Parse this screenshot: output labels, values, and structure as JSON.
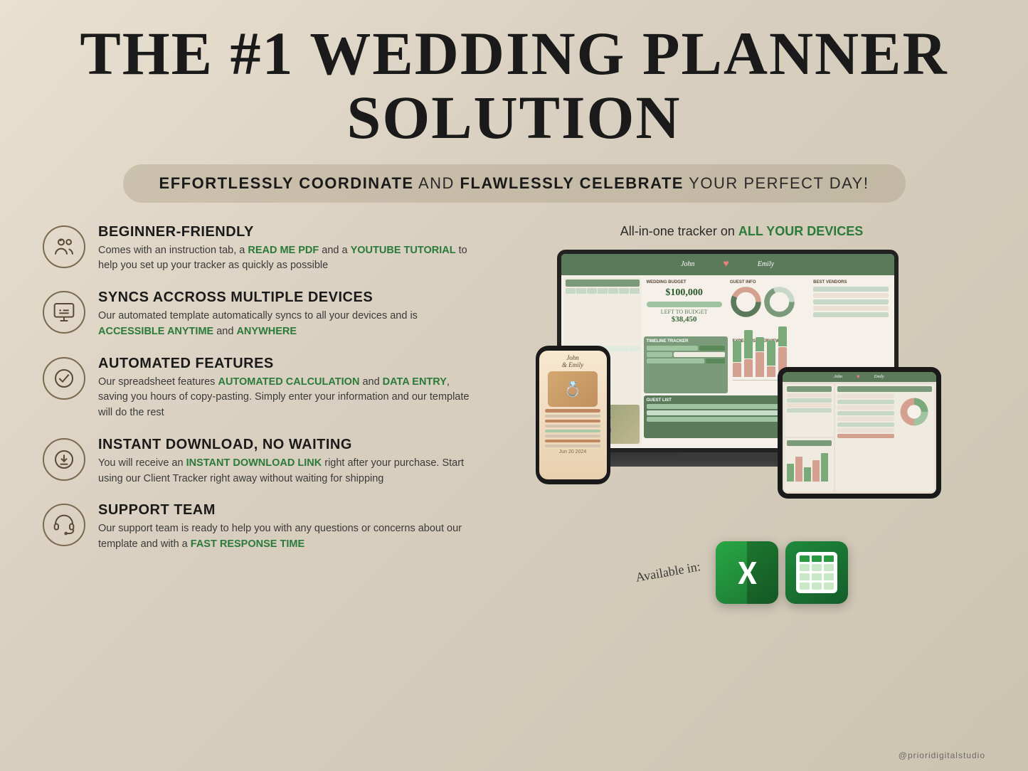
{
  "header": {
    "title_line1": "THE #1 WEDDING PLANNER",
    "title_line2": "SOLUTION",
    "subtitle_bold1": "EFFORTLESSLY COORDINATE",
    "subtitle_and": " AND ",
    "subtitle_bold2": "FLAWLESSLY CELEBRATE",
    "subtitle_rest": " YOUR PERFECT DAY!"
  },
  "features": [
    {
      "id": "beginner",
      "title": "BEGINNER-FRIENDLY",
      "desc_before": "Comes with an instruction tab, a ",
      "link1": "READ ME PDF",
      "desc_mid": " and a ",
      "link2": "YOUTUBE TUTORIAL",
      "desc_after": " to help you set up your tracker as quickly as possible",
      "icon": "users-icon"
    },
    {
      "id": "syncs",
      "title": "SYNCS ACCROSS MULTIPLE DEVICES",
      "desc_before": "Our automated template automatically syncs to all your devices and is ",
      "link1": "ACCESSIBLE ANYTIME",
      "desc_mid": " and ",
      "link2": "ANYWHERE",
      "desc_after": "",
      "icon": "monitor-icon"
    },
    {
      "id": "automated",
      "title": "AUTOMATED FEATURES",
      "desc_before": "Our spreadsheet features ",
      "link1": "AUTOMATED CALCULATION",
      "desc_mid": " and ",
      "link2": "DATA ENTRY",
      "desc_after": ", saving you hours of copy-pasting. Simply enter your information and our template will do the rest",
      "icon": "check-circle-icon"
    },
    {
      "id": "download",
      "title": "INSTANT DOWNLOAD, NO WAITING",
      "desc_before": "You will receive an ",
      "link1": "INSTANT DOWNLOAD LINK",
      "desc_mid": " right after your purchase. Start using our Client Tracker right away without waiting for shipping",
      "link2": "",
      "desc_after": "",
      "icon": "download-icon"
    },
    {
      "id": "support",
      "title": "SUPPORT TEAM",
      "desc_before": "Our support team is ready to help you with any questions or concerns about our template and with a ",
      "link1": "FAST RESPONSE TIME",
      "desc_mid": "",
      "link2": "",
      "desc_after": "",
      "icon": "headset-icon"
    }
  ],
  "right_side": {
    "devices_label_before": "All-in-one tracker on ",
    "devices_label_highlight": "ALL YOUR DEVICES",
    "available_label": "Available in:"
  },
  "footer": {
    "handle": "@prioridigitalstudio"
  },
  "colors": {
    "green_link": "#2a7a3a",
    "title_color": "#1a1a1a",
    "body_text": "#3a3a3a",
    "background_start": "#e8e0d0",
    "background_end": "#ccc4b0"
  }
}
